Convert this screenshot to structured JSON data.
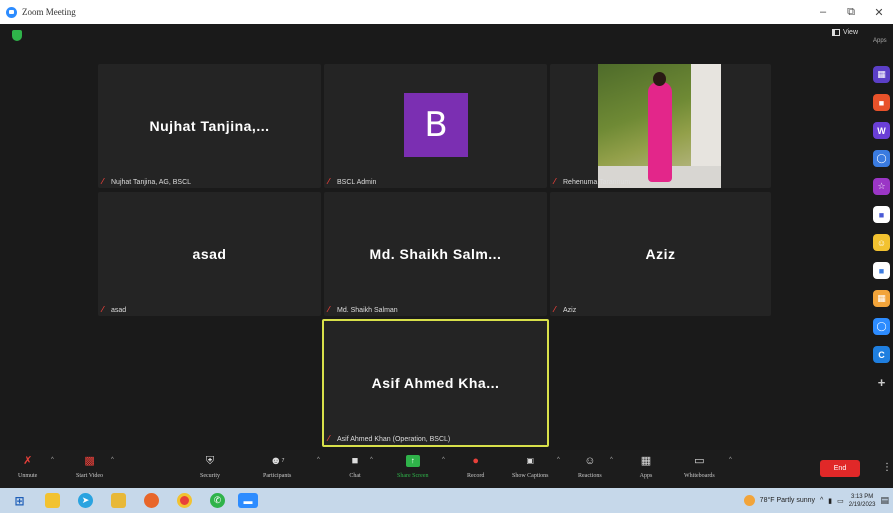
{
  "window": {
    "title": "Zoom Meeting",
    "controls": [
      "–",
      "⧉",
      "✕"
    ]
  },
  "top": {
    "view_label": "View",
    "apps_label": "Apps"
  },
  "tiles": [
    {
      "display": "Nujhat  Tanjina,...",
      "label": "Nujhat Tanjina, AG, BSCL"
    },
    {
      "display": "B",
      "label": "BSCL Admin"
    },
    {
      "display": "",
      "label": "Rehenuma Tarannum"
    },
    {
      "display": "asad",
      "label": "asad"
    },
    {
      "display": "Md.  Shaikh  Salm...",
      "label": "Md. Shaikh Salman"
    },
    {
      "display": "Aziz",
      "label": "Aziz"
    },
    {
      "display": "Asif  Ahmed  Kha...",
      "label": "Asif Ahmed Khan (Operation, BSCL)"
    }
  ],
  "controls": {
    "unmute": "Unmute",
    "start_video": "Start Video",
    "security": "Security",
    "participants": "Participants",
    "participants_count": "7",
    "chat": "Chat",
    "share_screen": "Share Screen",
    "record": "Record",
    "show_captions": "Show Captions",
    "reactions": "Reactions",
    "apps": "Apps",
    "whiteboards": "Whiteboards",
    "end": "End"
  },
  "taskbar": {
    "weather": "78°F  Partly sunny",
    "time": "3:13 PM",
    "date": "2/19/2023"
  },
  "colors": {
    "accent": "#2d8cff",
    "end": "#e02828",
    "active_border": "#d8e04a",
    "share_green": "#2fb34a"
  }
}
